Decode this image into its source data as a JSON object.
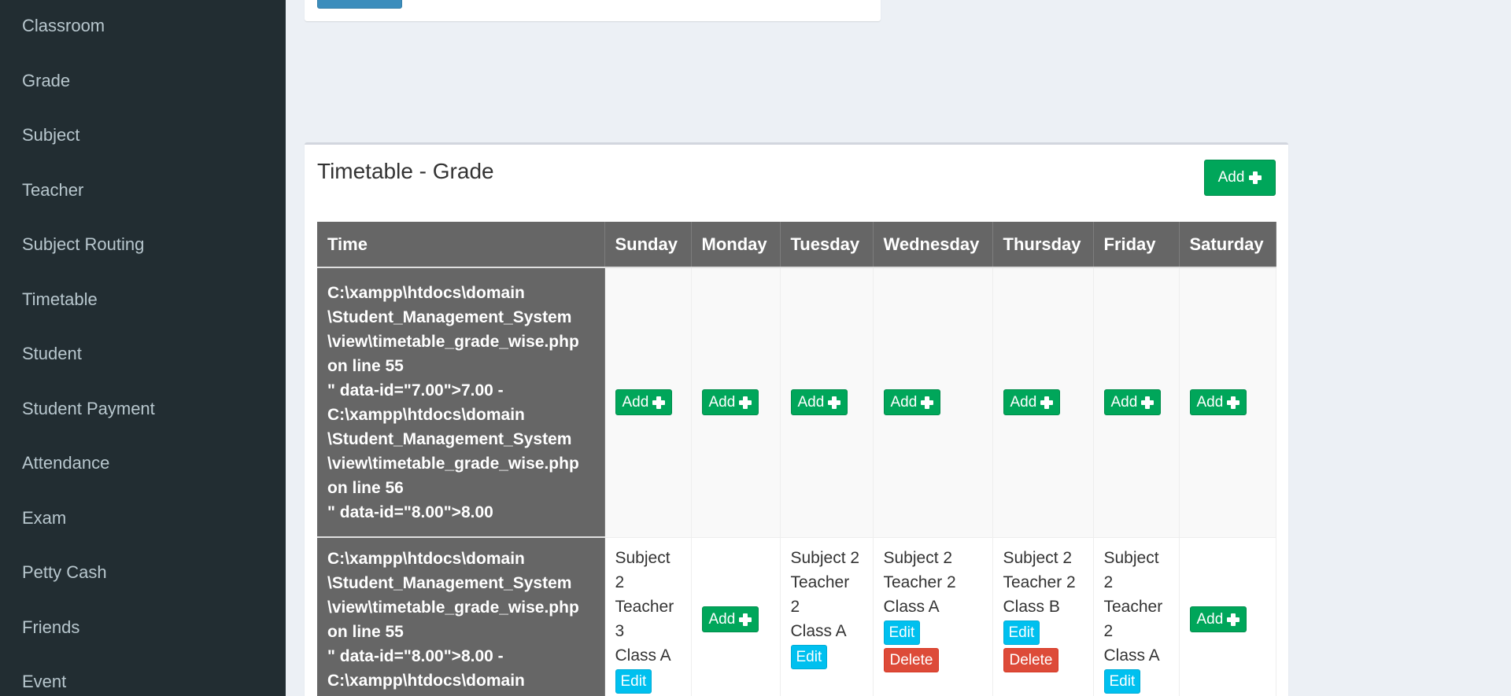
{
  "sidebar": {
    "items": [
      {
        "label": "Classroom"
      },
      {
        "label": "Grade"
      },
      {
        "label": "Subject"
      },
      {
        "label": "Teacher"
      },
      {
        "label": "Subject Routing"
      },
      {
        "label": "Timetable"
      },
      {
        "label": "Student"
      },
      {
        "label": "Student Payment"
      },
      {
        "label": "Attendance"
      },
      {
        "label": "Exam"
      },
      {
        "label": "Petty Cash"
      },
      {
        "label": "Friends"
      },
      {
        "label": "Event"
      }
    ]
  },
  "timetable": {
    "title": "Timetable - Grade",
    "add_label": "Add",
    "headers": [
      "Time",
      "Sunday",
      "Monday",
      "Tuesday",
      "Wednesday",
      "Thursday",
      "Friday",
      "Saturday"
    ],
    "rows": [
      {
        "time": "C:\\xampp\\htdocs\\domain\n\\Student_Management_System\n\\view\\timetable_grade_wise.php\non line 55\n\" data-id=\"7.00\">7.00 -\nC:\\xampp\\htdocs\\domain\n\\Student_Management_System\n\\view\\timetable_grade_wise.php\non line 56\n\" data-id=\"8.00\">8.00"
      },
      {
        "time": "C:\\xampp\\htdocs\\domain\n\\Student_Management_System\n\\view\\timetable_grade_wise.php\non line 55\n\" data-id=\"8.00\">8.00 -\nC:\\xampp\\htdocs\\domain",
        "sunday": {
          "subject": "Subject 2",
          "teacher": "Teacher 3",
          "class": "Class A"
        },
        "tuesday": {
          "subject": "Subject 2",
          "teacher": "Teacher 2",
          "class": "Class A"
        },
        "wednesday": {
          "subject": "Subject 2",
          "teacher": "Teacher 2",
          "class": "Class A"
        },
        "thursday": {
          "subject": "Subject 2",
          "teacher": "Teacher 2",
          "class": "Class B"
        },
        "friday": {
          "subject": "Subject 2",
          "teacher": "Teacher 2",
          "class": "Class A"
        }
      }
    ],
    "cell_add_label": "Add",
    "edit_label": "Edit",
    "delete_label": "Delete"
  },
  "colors": {
    "sidebar_bg": "#222d32",
    "page_bg": "#ecf0f5",
    "success": "#00a65a",
    "info": "#00c0ef",
    "danger": "#dd4b39",
    "header_bg": "#666666"
  },
  "icons": {
    "add": "plus-icon"
  }
}
